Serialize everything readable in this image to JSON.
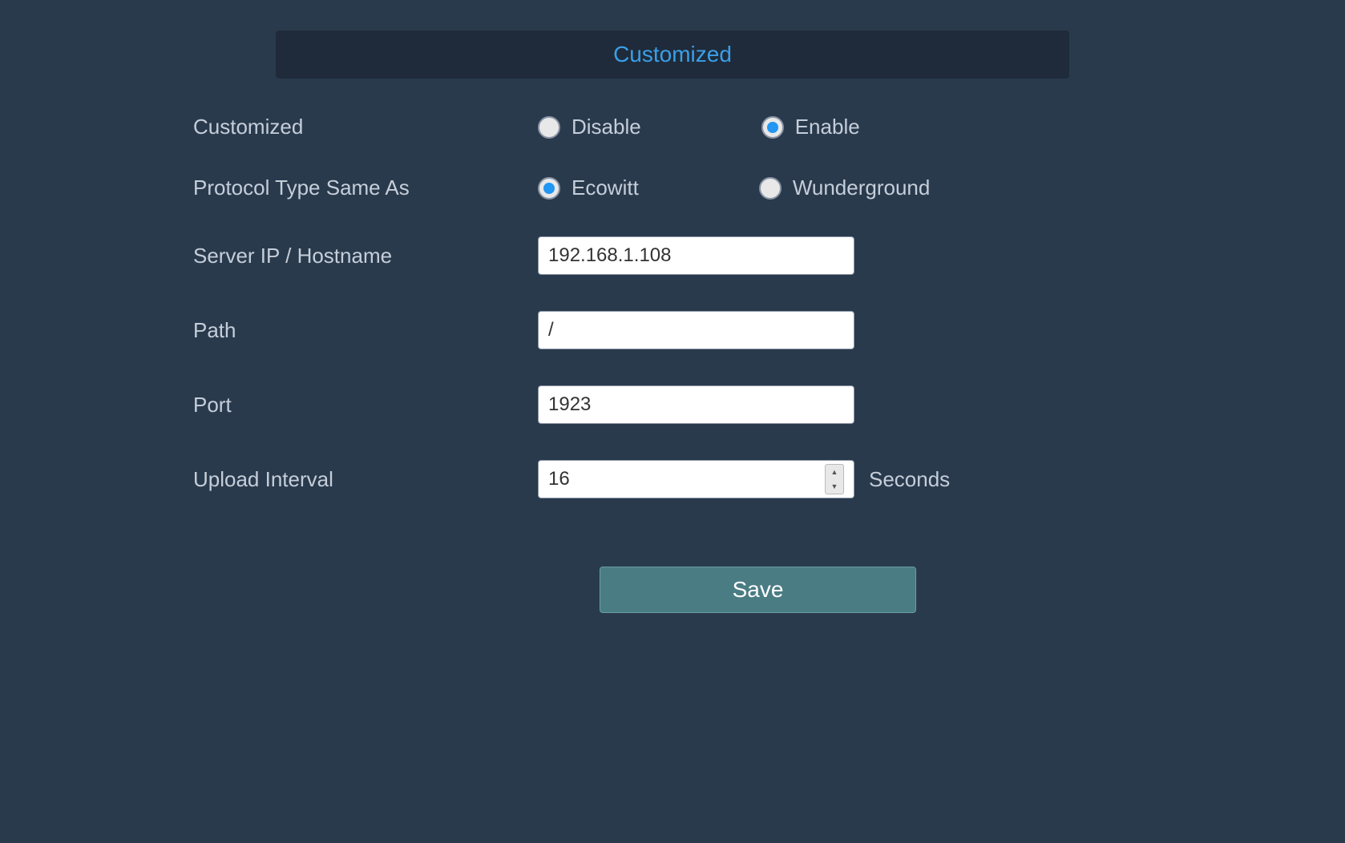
{
  "header": {
    "title": "Customized"
  },
  "form": {
    "customized": {
      "label": "Customized",
      "option_disable": "Disable",
      "option_enable": "Enable",
      "selected": "enable"
    },
    "protocol": {
      "label": "Protocol Type Same As",
      "option_ecowitt": "Ecowitt",
      "option_wunderground": "Wunderground",
      "selected": "ecowitt"
    },
    "server": {
      "label": "Server IP / Hostname",
      "value": "192.168.1.108"
    },
    "path": {
      "label": "Path",
      "value": "/"
    },
    "port": {
      "label": "Port",
      "value": "1923"
    },
    "interval": {
      "label": "Upload Interval",
      "value": "16",
      "unit": "Seconds"
    }
  },
  "buttons": {
    "save": "Save"
  }
}
